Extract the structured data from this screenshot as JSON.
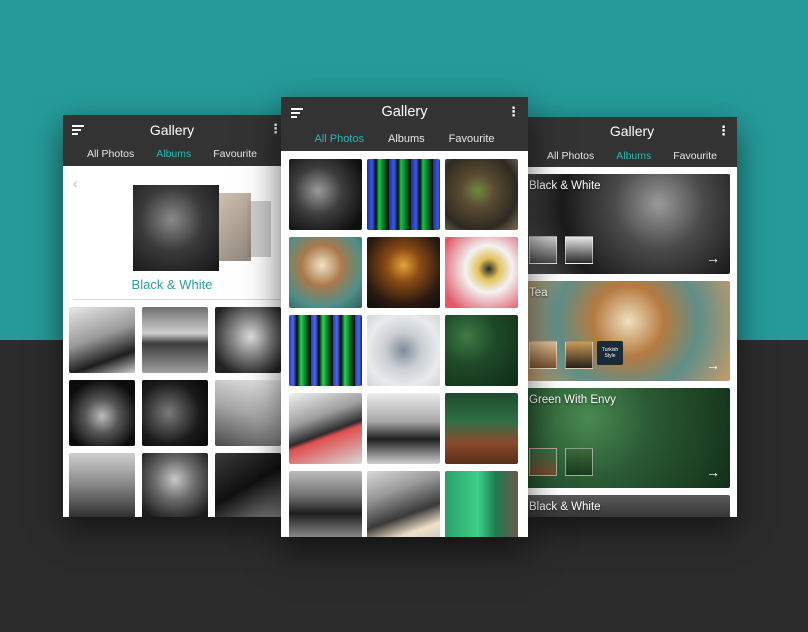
{
  "app": {
    "title": "Gallery",
    "tabs": [
      "All Photos",
      "Albums",
      "Favourite"
    ],
    "more_glyph": "⋮"
  },
  "left_screen": {
    "active_tab": "Albums",
    "back_glyph": "‹",
    "album_title": "Black & White"
  },
  "middle_screen": {
    "active_tab": "All Photos"
  },
  "right_screen": {
    "active_tab": "Albums",
    "albums": [
      {
        "name": "Black & White",
        "arrow": "→"
      },
      {
        "name": "Tea",
        "arrow": "→",
        "inner_label": "Turkish Style"
      },
      {
        "name": "Green With Envy",
        "arrow": "→"
      },
      {
        "name": "Black & White"
      }
    ]
  },
  "colors": {
    "teal_background": "#269a9a",
    "dark_background": "#2c2c2c",
    "appbar": "#333333",
    "accent": "#2bb5b5"
  },
  "icons": [
    "menu-icon",
    "more-vert-icon",
    "back-chevron-icon",
    "arrow-right-icon"
  ]
}
